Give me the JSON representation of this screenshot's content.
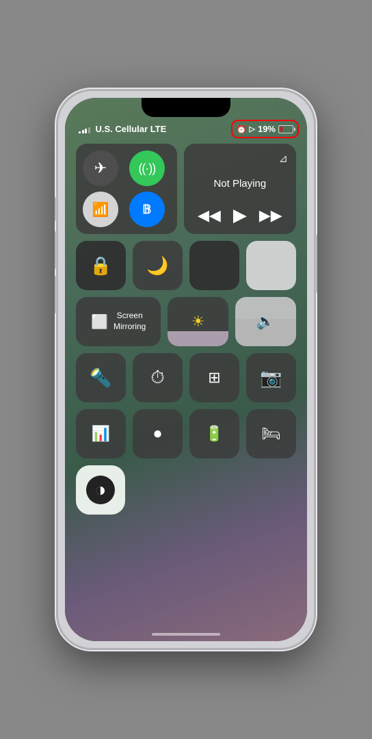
{
  "phone": {
    "statusBar": {
      "carrier": "U.S. Cellular LTE",
      "alarmIcon": "⏰",
      "locationIcon": "◂",
      "batteryPercent": "19%",
      "signalBars": [
        3,
        5,
        7,
        9,
        11
      ]
    },
    "controlCenter": {
      "mediaPlayer": {
        "title": "Not Playing",
        "airplayLabel": "airplay",
        "rewindLabel": "⏮",
        "playLabel": "▶",
        "fastforwardLabel": "⏭"
      },
      "connectivity": {
        "airplane": "✈",
        "wifi_active": "((·))",
        "wifi_inactive": "WiFi",
        "bluetooth": "Bluetooth"
      },
      "screenMirroring": {
        "label": "Screen\nMirroring"
      },
      "brightness": {
        "icon": "☀"
      },
      "volume": {
        "icon": "🔈"
      },
      "utilities": {
        "flashlight": "🔦",
        "timer": "⏱",
        "calculator": "⊞",
        "camera": "📷",
        "voice_memo": "🎤",
        "screen_record": "⏺",
        "battery_widget": "🔋",
        "bed": "🛏"
      },
      "accessibility": {
        "label": "Accessibility Shortcut"
      }
    }
  }
}
